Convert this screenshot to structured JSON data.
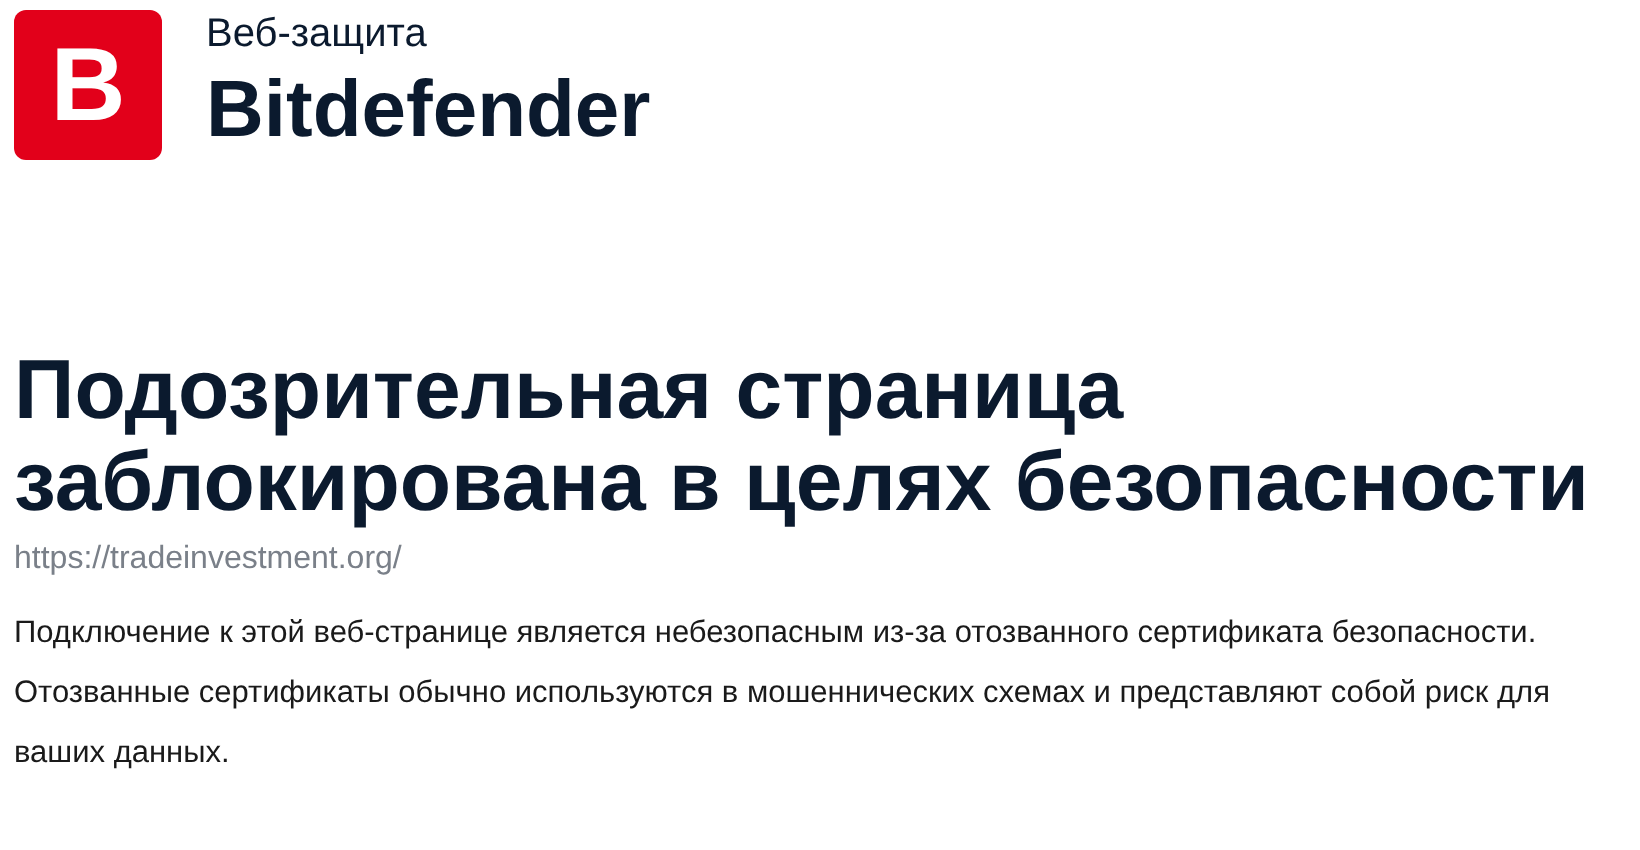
{
  "header": {
    "logo_letter": "B",
    "product": "Веб-защита",
    "brand": "Bitdefender"
  },
  "title": "Подозрительная страница заблокирована в целях безопасности",
  "url": "https://tradeinvestment.org/",
  "paragraphs": [
    "Подключение к этой веб-странице является небезопасным из-за отозванного сертификата безопасности.",
    "Отозванные сертификаты обычно используются в мошеннических схемах и представляют собой риск для ваших данных."
  ]
}
